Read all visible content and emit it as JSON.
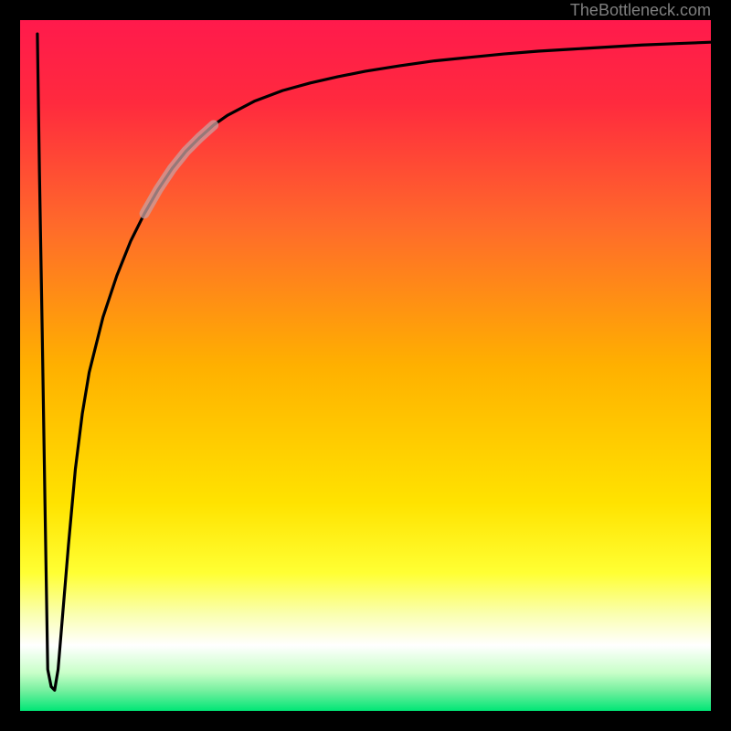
{
  "watermark": "TheBottleneck.com",
  "colors": {
    "bg": "#000000",
    "frame": "#000000",
    "gradient_stops": [
      {
        "offset": 0.0,
        "color": "#ff1a4c"
      },
      {
        "offset": 0.12,
        "color": "#ff2a3e"
      },
      {
        "offset": 0.3,
        "color": "#ff6b2a"
      },
      {
        "offset": 0.5,
        "color": "#ffb000"
      },
      {
        "offset": 0.7,
        "color": "#ffe300"
      },
      {
        "offset": 0.8,
        "color": "#ffff33"
      },
      {
        "offset": 0.86,
        "color": "#faffb0"
      },
      {
        "offset": 0.905,
        "color": "#ffffff"
      },
      {
        "offset": 0.945,
        "color": "#c8ffc8"
      },
      {
        "offset": 0.97,
        "color": "#78f0a0"
      },
      {
        "offset": 1.0,
        "color": "#00e676"
      }
    ],
    "curve": "#000000",
    "highlight": "#caa0a0"
  },
  "chart_data": {
    "type": "line",
    "title": "",
    "xlabel": "",
    "ylabel": "",
    "xlim": [
      0,
      100
    ],
    "ylim": [
      0,
      100
    ],
    "grid": false,
    "legend": false,
    "note": "Values are coordinates in percent of the plot area. y=0 is the bottom (optimum / green), y=100 is the top (worst / red). The curve falls from ~98 to a dip near x≈4 (y≈3) and then rises asymptotically toward ~97 at the right edge. A lighter segment highlights roughly x∈[18,28] on the rising curve.",
    "series": [
      {
        "name": "bottleneck-curve",
        "x": [
          2.5,
          2.8,
          3.2,
          3.6,
          4.0,
          4.5,
          5.0,
          5.5,
          6.0,
          7.0,
          8.0,
          9.0,
          10,
          12,
          14,
          16,
          18,
          20,
          22,
          24,
          26,
          28,
          30,
          34,
          38,
          42,
          46,
          50,
          55,
          60,
          65,
          70,
          75,
          80,
          85,
          90,
          95,
          100
        ],
        "y": [
          98,
          78,
          55,
          30,
          6,
          3.5,
          3.0,
          6,
          12,
          24,
          35,
          43,
          49,
          57,
          63,
          68,
          72,
          75.5,
          78.5,
          81,
          83,
          84.8,
          86.2,
          88.3,
          89.8,
          90.9,
          91.8,
          92.6,
          93.4,
          94.1,
          94.6,
          95.1,
          95.5,
          95.8,
          96.1,
          96.4,
          96.6,
          96.8
        ]
      }
    ],
    "highlight_range_x": [
      18,
      28
    ]
  }
}
